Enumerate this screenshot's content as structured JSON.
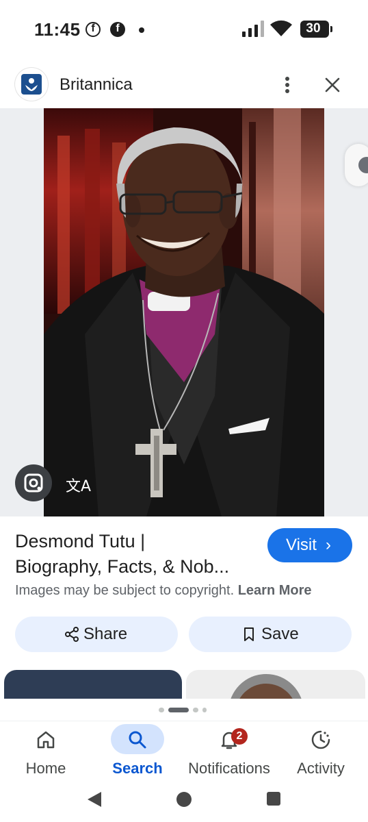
{
  "status_bar": {
    "time": "11:45",
    "battery": "30",
    "icons": [
      "facebook-outline-icon",
      "facebook-icon",
      "notification-dot-icon",
      "signal-icon",
      "wifi-icon",
      "battery-icon"
    ]
  },
  "source": {
    "name": "Britannica",
    "logo_icon": "britannica-logo-icon",
    "more_icon": "more-vert-icon",
    "close_icon": "close-icon"
  },
  "image": {
    "subject_icon": "photo-portrait",
    "lens_icon": "google-lens-icon",
    "translate_icon": "translate-icon",
    "translate_glyph": "文A"
  },
  "result": {
    "title_line1": "Desmond Tutu |",
    "title_line2": "Biography, Facts, & Nob...",
    "visit_label": "Visit",
    "visit_chevron": "›",
    "copyright_text": "Images may be subject to copyright.",
    "learn_more": "Learn More",
    "share_label": "Share",
    "save_label": "Save"
  },
  "bottom_nav": {
    "items": [
      {
        "label": "Home",
        "icon": "home-icon"
      },
      {
        "label": "Search",
        "icon": "search-icon"
      },
      {
        "label": "Notifications",
        "icon": "bell-icon",
        "badge": "2"
      },
      {
        "label": "Activity",
        "icon": "activity-icon"
      }
    ]
  },
  "colors": {
    "accent": "#1a73e8",
    "pill_bg": "#e8f0fe",
    "active_nav_bg": "#d3e3fd",
    "badge": "#b3261e"
  }
}
